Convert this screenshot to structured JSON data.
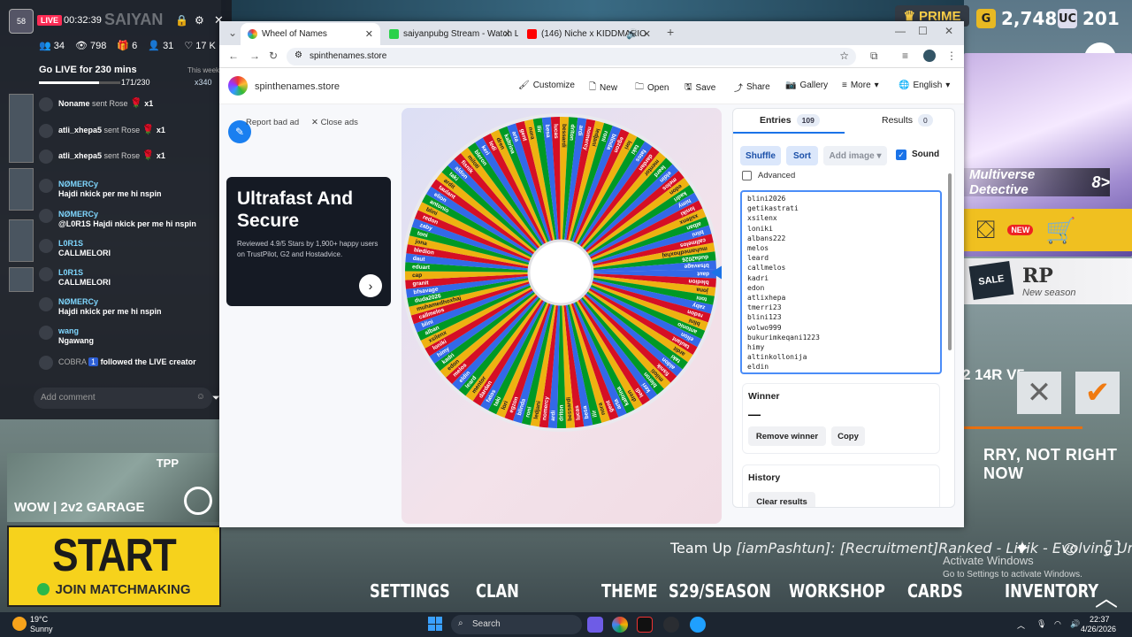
{
  "game": {
    "currency1": "2,748",
    "currency2": "201",
    "prime": "PRIME",
    "multiverse": "Multiverse Detective",
    "new_label": "NEW",
    "rp": "RP",
    "rp_sub": "New season",
    "sale": "SALE",
    "rank_mode": "2 14R V5",
    "sorry": "RRY, NOT RIGHT NOW",
    "team_up": "Team Up",
    "team_msg": "[iamPashtun]: [Recruitment]Ranked - Livik - Evolving Univ",
    "garage": "WOW | 2v2 GARAGE",
    "tpp": "TPP",
    "start": "START",
    "join": "JOIN MATCHMAKING",
    "nav": [
      "SETTINGS",
      "CLAN",
      "THEME",
      "S29/SEASON",
      "WORKSHOP",
      "CARDS",
      "INVENTORY"
    ],
    "activate_title": "Activate Windows",
    "activate_sub": "Go to Settings to activate Windows."
  },
  "live": {
    "badge": "LIVE",
    "timer": "00:32:39",
    "channel": "SAIYAN",
    "stats": [
      "34",
      "798",
      "6",
      "31",
      "17 K"
    ],
    "goal": "Go LIVE for 230 mins",
    "goal_period": "This week",
    "progress_text": "171/230",
    "progress": 0.74,
    "multiplier": "x340",
    "chat": [
      {
        "name": "Noname",
        "msg": "sent Rose",
        "extra": "x1"
      },
      {
        "name": "atli_xhepa5",
        "msg": "sent Rose",
        "extra": "x1"
      },
      {
        "name": "atli_xhepa5",
        "msg": "sent Rose",
        "extra": "x1"
      },
      {
        "name": "NØMERCy",
        "msg": "Hajdi nkick per me hi nspin",
        "extra": ""
      },
      {
        "name": "NØMERCy",
        "msg": "@L0R1S Hajdi nkick per me hi nspin",
        "extra": ""
      },
      {
        "name": "L0R1S",
        "msg": "CALLMELORI",
        "extra": ""
      },
      {
        "name": "L0R1S",
        "msg": "CALLMELORI",
        "extra": ""
      },
      {
        "name": "NØMERCy",
        "msg": "Hajdi nkick per me hi nspin",
        "extra": ""
      },
      {
        "name": "wang",
        "msg": "Ngawang",
        "extra": ""
      },
      {
        "name": "COBRA",
        "msg": "followed the LIVE creator",
        "extra": "1"
      }
    ],
    "comment_placeholder": "Add comment"
  },
  "browser": {
    "tabs": [
      {
        "title": "Wheel of Names",
        "color": "#4285f4"
      },
      {
        "title": "saiyanpubg Stream - Watch Live",
        "color": "#2ad14a"
      },
      {
        "title": "(146) Niche x KIDDMARIO",
        "color": "#ff0000"
      }
    ],
    "url": "spinthenames.store",
    "site_name": "spinthenames.store",
    "menu": [
      "Customize",
      "New",
      "Open",
      "Save",
      "Share",
      "Gallery",
      "More",
      "English"
    ],
    "report_ad": "Report bad ad",
    "close_ads": "Close ads",
    "ad_title": "Ultrafast And Secure",
    "ad_text": "Reviewed 4.9/5 Stars by 1,900+ happy users on TrustPilot, G2 and Hostadvice."
  },
  "panel": {
    "entries_tab": "Entries",
    "entries_count": "109",
    "results_tab": "Results",
    "results_count": "0",
    "shuffle": "Shuffle",
    "sort": "Sort",
    "add_image": "Add image",
    "sound": "Sound",
    "advanced": "Advanced",
    "entries": [
      "blini2026",
      "getikastrati",
      "xsilenx",
      "loniki",
      "albans222",
      "melos",
      "leard",
      "callmelos",
      "kadri",
      "edon",
      "atlixhepa",
      "tmerri23",
      "blini123",
      "wolwo999",
      "bukurimkeqani1223",
      "himy",
      "altinkollonija",
      "eldin"
    ],
    "winner_title": "Winner",
    "winner_value": "—",
    "remove_winner": "Remove winner",
    "copy": "Copy",
    "history_title": "History",
    "clear_results": "Clear results"
  },
  "wheel_labels": [
    "daut",
    "bledion",
    "jona",
    "toni",
    "zaby",
    "redon",
    "blini",
    "antonio",
    "elion",
    "taulant",
    "ardit",
    "taki",
    "aldon",
    "fisnik",
    "miloti",
    "bleron",
    "keri",
    "ledi",
    "dren",
    "kaltrina",
    "arta",
    "gent",
    "nora",
    "ilir",
    "besa",
    "lucas",
    "bessardi",
    "driton",
    "ardi",
    "nomercy",
    "ledjani",
    "roni",
    "blinda",
    "egzon",
    "lori",
    "taki",
    "fatos",
    "dardan",
    "mentor",
    "leard",
    "eldin",
    "melos",
    "edon",
    "kadri",
    "himy",
    "loniki",
    "xsilenx",
    "alban",
    "blini",
    "callmelos",
    "muhamedhoxhaj",
    "duda2026",
    "bfsavage",
    "granit",
    "cap",
    "eduart"
  ],
  "taskbar": {
    "weather_temp": "19°C",
    "weather_desc": "Sunny",
    "search": "Search",
    "time": "22:37",
    "date": "4/26/2026"
  },
  "colors": {
    "accent": "#1a73e8",
    "wheel": [
      "#3369e8",
      "#d50f25",
      "#eeb211",
      "#009925"
    ]
  }
}
